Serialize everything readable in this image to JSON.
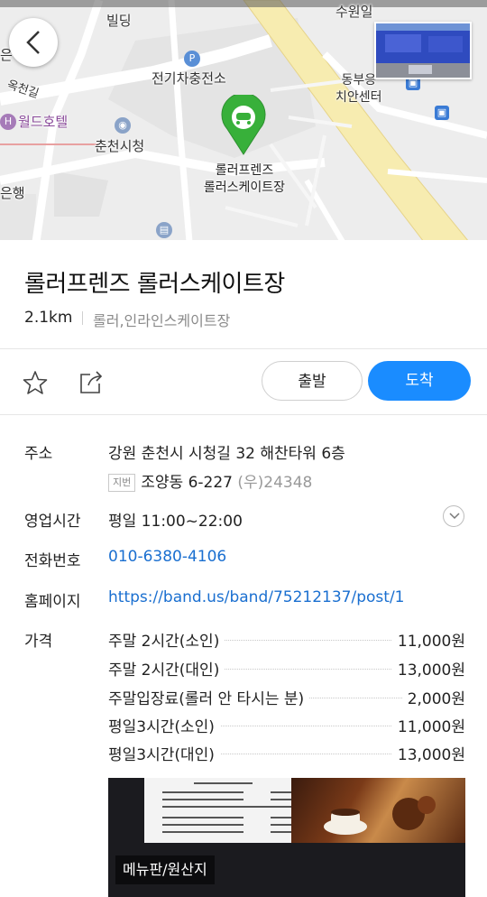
{
  "map": {
    "labels": {
      "building_top": "빌딩",
      "ev_charging": "전기차충전소",
      "dental_center": "동부응\n치안센터",
      "world_hotel": "월드호텔",
      "city_hall": "춘천시청",
      "place_marker": "롤러프렌즈\n롤러스케이트장",
      "bank": "은행",
      "top_right_partial": "수원일",
      "left_partial_1": "은",
      "left_partial_2": "옥천길"
    }
  },
  "place": {
    "title": "롤러프렌즈 롤러스케이트장",
    "distance": "2.1km",
    "category": "롤러,인라인스케이트장"
  },
  "actions": {
    "depart_label": "출발",
    "arrive_label": "도착",
    "arrive_color": "#1a8cff"
  },
  "details": {
    "address": {
      "label": "주소",
      "road": "강원 춘천시 시청길 32 해찬타워 6층",
      "jibun_badge": "지번",
      "jibun": "조양동 6-227",
      "postal": "(우)24348"
    },
    "hours": {
      "label": "영업시간",
      "value": "평일 11:00~22:00"
    },
    "phone": {
      "label": "전화번호",
      "value": "010-6380-4106"
    },
    "homepage": {
      "label": "홈페이지",
      "value": "https://band.us/band/75212137/post/1"
    },
    "price": {
      "label": "가격",
      "items": [
        {
          "name": "주말 2시간(소인)",
          "value": "11,000원"
        },
        {
          "name": "주말 2시간(대인)",
          "value": "13,000원"
        },
        {
          "name": "주말입장료(롤러 안 타시는 분)",
          "value": "2,000원"
        },
        {
          "name": "평일3시간(소인)",
          "value": "11,000원"
        },
        {
          "name": "평일3시간(대인)",
          "value": "13,000원"
        }
      ]
    },
    "menu_photo_caption": "메뉴판/원산지"
  }
}
